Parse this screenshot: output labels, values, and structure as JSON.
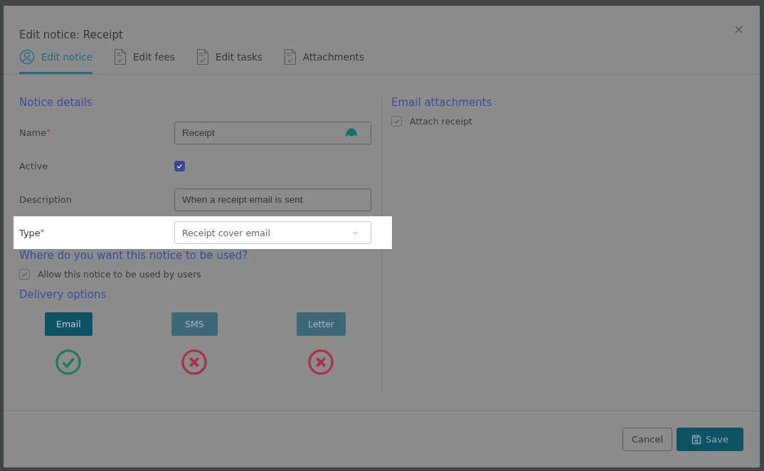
{
  "dialog": {
    "title": "Edit notice: Receipt",
    "close": "×"
  },
  "tabs": [
    {
      "label": "Edit notice",
      "selected": true
    },
    {
      "label": "Edit fees",
      "selected": false
    },
    {
      "label": "Edit tasks",
      "selected": false
    },
    {
      "label": "Attachments",
      "selected": false
    }
  ],
  "notice_details": {
    "heading": "Notice details",
    "fields": [
      {
        "kind": "text",
        "label": "Name",
        "required_mark": "*",
        "value": "Receipt",
        "highlighted": false,
        "badge": true
      },
      {
        "kind": "checkbox",
        "label": "Active",
        "checked": true,
        "highlighted": false
      },
      {
        "kind": "text",
        "label": "Description",
        "value": "When a receipt email is sent",
        "highlighted": false,
        "badge": false
      },
      {
        "kind": "select",
        "label": "Type",
        "required_mark": "*",
        "value": "Receipt cover email",
        "highlighted": true
      }
    ]
  },
  "usage": {
    "heading": "Where do you want this notice to be used?",
    "options": [
      {
        "label": "Allow this notice to be used by users",
        "checked": true
      }
    ]
  },
  "delivery": {
    "heading": "Delivery options",
    "options": [
      {
        "label": "Email",
        "enabled": true
      },
      {
        "label": "SMS",
        "enabled": false
      },
      {
        "label": "Letter",
        "enabled": false
      }
    ]
  },
  "email_attachments": {
    "heading": "Email attachments",
    "options": [
      {
        "label": "Attach receipt",
        "checked": true
      }
    ]
  },
  "buttons": [
    {
      "kind": "secondary",
      "label": "Cancel"
    },
    {
      "kind": "primary",
      "label": "Save"
    }
  ]
}
